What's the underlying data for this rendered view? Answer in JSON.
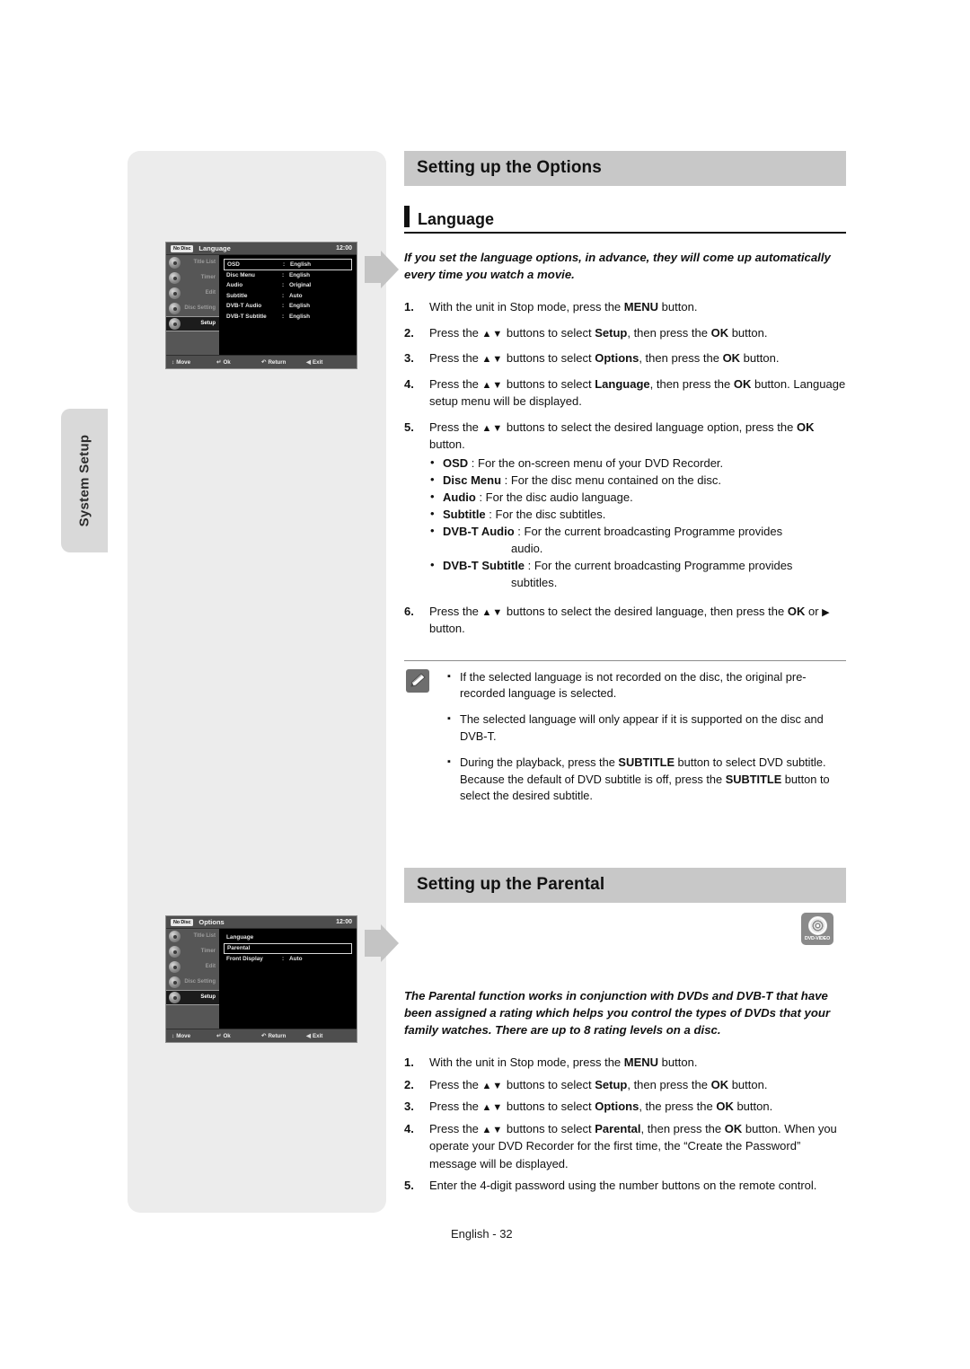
{
  "side_tab": {
    "label": "System Setup"
  },
  "page_footer": "English - 32",
  "sections": {
    "options": {
      "heading": "Setting up the Options",
      "sub_heading": "Language",
      "lead": "If you set the language options, in advance, they will come up automatically every time you watch a movie.",
      "steps": [
        {
          "num": "1.",
          "text_html": "With the unit in Stop mode, press the <b>MENU</b> button."
        },
        {
          "num": "2.",
          "text_html": "Press the <span class=\"arrows\">▲▼</span> buttons to select <b>Setup</b>, then press the <b>OK</b> button."
        },
        {
          "num": "3.",
          "text_html": "Press the <span class=\"arrows\">▲▼</span> buttons to select <b>Options</b>, then press the <b>OK</b> button."
        },
        {
          "num": "4.",
          "text_html": "Press the <span class=\"arrows\">▲▼</span> buttons to select <b>Language</b>, then press the <b>OK</b> button. Language setup menu will be displayed."
        },
        {
          "num": "5.",
          "text_html": "Press the <span class=\"arrows\">▲▼</span> buttons to select the desired language option, press the <b>OK</b> button."
        },
        {
          "num": "6.",
          "text_html": "Press the <span class=\"arrows\">▲▼</span> buttons to select the desired language, then press the <b>OK</b> or <span class=\"arrows\">▶</span> button."
        }
      ],
      "bullets": [
        {
          "term": "OSD",
          "desc": ": For the on-screen menu of your DVD Recorder."
        },
        {
          "term": "Disc Menu",
          "desc": ": For the disc menu contained on the disc."
        },
        {
          "term": "Audio",
          "desc": ": For the disc audio language."
        },
        {
          "term": "Subtitle",
          "desc": ": For the disc subtitles."
        },
        {
          "term": "DVB-T Audio",
          "desc": ": For the current broadcasting Programme provides",
          "cont": "audio."
        },
        {
          "term": "DVB-T Subtitle",
          "desc": ": For the current broadcasting Programme provides",
          "cont": "subtitles."
        }
      ],
      "notes": [
        "If the selected language is not recorded on the disc, the original pre-recorded language is selected.",
        "The selected language will only appear if it is supported on the disc and DVB-T.",
        "During the playback, press the <b>SUBTITLE</b> button to select DVD subtitle.  Because the default of DVD subtitle is off, press the <b>SUBTITLE</b> button to select the desired subtitle."
      ]
    },
    "parental": {
      "heading": "Setting up the Parental",
      "lead": "The Parental function works in conjunction with DVDs and DVB-T that have been assigned a rating which helps you control the types of DVDs that your family watches. There are up to 8 rating levels on a disc.",
      "badge_label": "DVD-VIDEO",
      "steps": [
        {
          "num": "1.",
          "text_html": "With the unit in Stop mode, press the <b>MENU</b> button."
        },
        {
          "num": "2.",
          "text_html": "Press the <span class=\"arrows\">▲▼</span> buttons to select <b>Setup</b>, then press the <b>OK</b> button."
        },
        {
          "num": "3.",
          "text_html": "Press the <span class=\"arrows\">▲▼</span> buttons to select <b>Options</b>, the press the <b>OK</b> button."
        },
        {
          "num": "4.",
          "text_html": "Press the <span class=\"arrows\">▲▼</span> buttons to select <b>Parental</b>, then press the <b>OK</b> button. When you operate your DVD Recorder for the first time, the “Create the Password” message will be displayed."
        },
        {
          "num": "5.",
          "text_html": "Enter the 4-digit password using the number buttons on the remote control."
        }
      ]
    }
  },
  "screens": [
    {
      "id": "language-screen",
      "disc_status": "No Disc",
      "title": "Language",
      "clock": "12:00",
      "sidebar": [
        {
          "label": "Title List",
          "selected": false
        },
        {
          "label": "Timer",
          "selected": false
        },
        {
          "label": "Edit",
          "selected": false
        },
        {
          "label": "Disc Setting",
          "selected": false
        },
        {
          "label": "Setup",
          "selected": true
        }
      ],
      "rows": [
        {
          "label": "OSD",
          "colon": ":",
          "value": "English",
          "highlight": true
        },
        {
          "label": "Disc Menu",
          "colon": ":",
          "value": "English",
          "highlight": false
        },
        {
          "label": "Audio",
          "colon": ":",
          "value": "Original",
          "highlight": false
        },
        {
          "label": "Subtitle",
          "colon": ":",
          "value": "Auto",
          "highlight": false
        },
        {
          "label": "DVB-T Audio",
          "colon": ":",
          "value": "English",
          "highlight": false
        },
        {
          "label": "DVB-T Subtitle",
          "colon": ":",
          "value": "English",
          "highlight": false
        }
      ],
      "footer": [
        {
          "glyph": "↕",
          "label": "Move"
        },
        {
          "glyph": "↵",
          "label": "Ok"
        },
        {
          "glyph": "↶",
          "label": "Return"
        },
        {
          "glyph": "◀",
          "label": "Exit"
        }
      ]
    },
    {
      "id": "options-screen",
      "disc_status": "No Disc",
      "title": "Options",
      "clock": "12:00",
      "sidebar": [
        {
          "label": "Title List",
          "selected": false
        },
        {
          "label": "Timer",
          "selected": false
        },
        {
          "label": "Edit",
          "selected": false
        },
        {
          "label": "Disc Setting",
          "selected": false
        },
        {
          "label": "Setup",
          "selected": true
        }
      ],
      "rows": [
        {
          "label": "Language",
          "colon": "",
          "value": "",
          "highlight": false
        },
        {
          "label": "Parental",
          "colon": "",
          "value": "",
          "highlight": true
        },
        {
          "label": "Front Display",
          "colon": ":",
          "value": "Auto",
          "highlight": false
        }
      ],
      "footer": [
        {
          "glyph": "↕",
          "label": "Move"
        },
        {
          "glyph": "↵",
          "label": "Ok"
        },
        {
          "glyph": "↶",
          "label": "Return"
        },
        {
          "glyph": "◀",
          "label": "Exit"
        }
      ]
    }
  ]
}
